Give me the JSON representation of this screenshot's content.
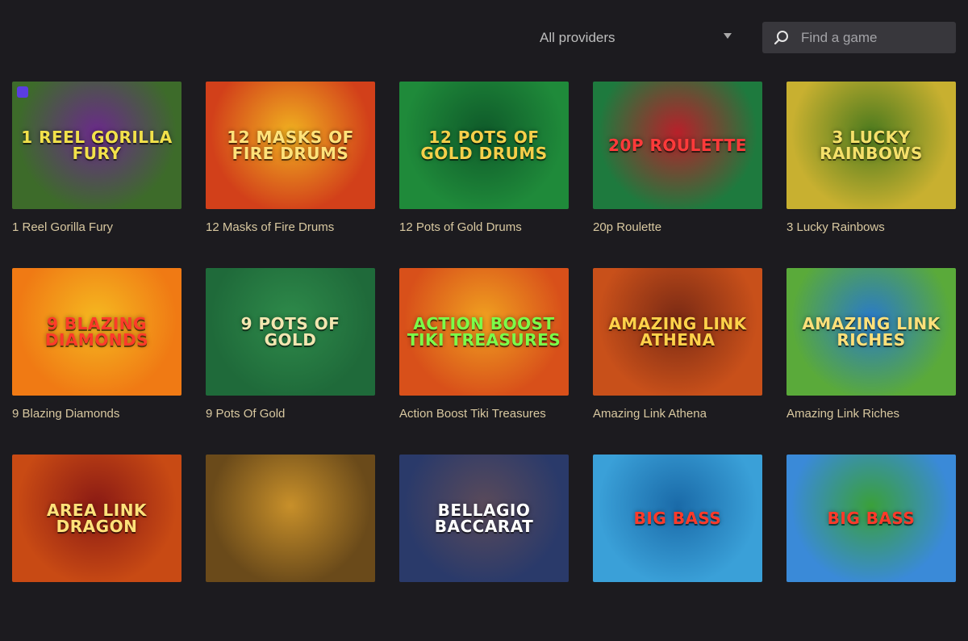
{
  "filters": {
    "provider_selected": "All providers",
    "search_placeholder": "Find a game",
    "search_icon": "search-icon",
    "dropdown_icon": "caret-down-icon"
  },
  "games": [
    {
      "title": "1 Reel Gorilla Fury",
      "logo": "1 Reel Gorilla Fury",
      "bg": "#3d6b2a",
      "bg2": "#6a2a8a",
      "fg": "#f2e14a"
    },
    {
      "title": "12 Masks of Fire Drums",
      "logo": "12 Masks of Fire Drums",
      "bg": "#d2401a",
      "bg2": "#f0b020",
      "fg": "#ffe27a"
    },
    {
      "title": "12 Pots of Gold Drums",
      "logo": "12 Pots of Gold Drums",
      "bg": "#1f8a3a",
      "bg2": "#0f5a2a",
      "fg": "#f5cf4a"
    },
    {
      "title": "20p Roulette",
      "logo": "20p Roulette",
      "bg": "#1e7a3e",
      "bg2": "#b8202a",
      "fg": "#ff3a3a"
    },
    {
      "title": "3 Lucky Rainbows",
      "logo": "3 Lucky Rainbows",
      "bg": "#c8b030",
      "bg2": "#4c7a1e",
      "fg": "#f5e06a"
    },
    {
      "title": "9 Blazing Diamonds",
      "logo": "9 Blazing Diamonds",
      "bg": "#f07a14",
      "bg2": "#f5b820",
      "fg": "#ff3a2a"
    },
    {
      "title": "9 Pots Of Gold",
      "logo": "9 Pots Of Gold",
      "bg": "#1f6a3a",
      "bg2": "#2e8a4a",
      "fg": "#f2e6b0"
    },
    {
      "title": "Action Boost Tiki Treasures",
      "logo": "Action Boost Tiki Treasures",
      "bg": "#d8501a",
      "bg2": "#f0a020",
      "fg": "#7aff4a"
    },
    {
      "title": "Amazing Link Athena",
      "logo": "Amazing Link Athena",
      "bg": "#c8501a",
      "bg2": "#7a2a14",
      "fg": "#ffd24a"
    },
    {
      "title": "Amazing Link Riches",
      "logo": "Amazing Link Riches",
      "bg": "#5aaa3a",
      "bg2": "#2a7ac8",
      "fg": "#ffe07a"
    },
    {
      "title": "",
      "logo": "Area Link Dragon",
      "bg": "#c84a14",
      "bg2": "#8a1a14",
      "fg": "#ffe27a"
    },
    {
      "title": "",
      "logo": "",
      "bg": "#6a4a1a",
      "bg2": "#c8902a",
      "fg": "#ffd24a"
    },
    {
      "title": "",
      "logo": "Bellagio Baccarat",
      "bg": "#2a3a6a",
      "bg2": "#5a4a5a",
      "fg": "#ffffff"
    },
    {
      "title": "",
      "logo": "Big Bass",
      "bg": "#3aa0d8",
      "bg2": "#1a6aa8",
      "fg": "#ff3a2a"
    },
    {
      "title": "",
      "logo": "Big Bass",
      "bg": "#3a8ad8",
      "bg2": "#3aa03a",
      "fg": "#ff3a2a"
    }
  ]
}
